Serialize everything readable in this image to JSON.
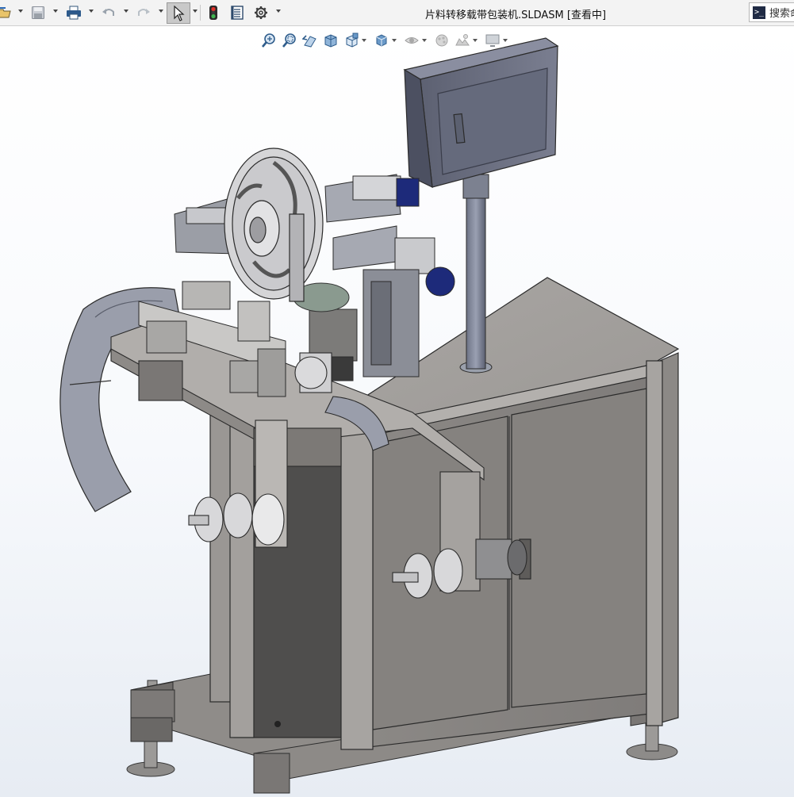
{
  "window": {
    "title": "片料转移载带包装机.SLDASM [查看中]"
  },
  "toolbar": {
    "buttons": [
      {
        "name": "open-icon"
      },
      {
        "name": "save-icon"
      },
      {
        "name": "print-icon"
      },
      {
        "name": "undo-icon"
      },
      {
        "name": "redo-icon"
      },
      {
        "name": "select-pointer-icon"
      },
      {
        "name": "rebuild-traffic-light-icon"
      },
      {
        "name": "file-properties-icon"
      },
      {
        "name": "options-gear-icon"
      }
    ]
  },
  "search": {
    "label": "搜索命"
  },
  "heads_up_toolbar": {
    "items": [
      "zoom-to-fit-icon",
      "zoom-to-area-icon",
      "previous-view-icon",
      "section-view-icon",
      "view-orientation-icon",
      "display-style-icon",
      "hide-show-items-icon",
      "edit-appearance-icon",
      "apply-scene-icon",
      "view-settings-icon"
    ]
  },
  "model": {
    "description_colors": {
      "cabinet": "#8a8785",
      "frame": "#a6a3a0",
      "panel": "#6b6f80",
      "motor": "#1d2a7a",
      "reel": "#d5d5d7"
    }
  }
}
